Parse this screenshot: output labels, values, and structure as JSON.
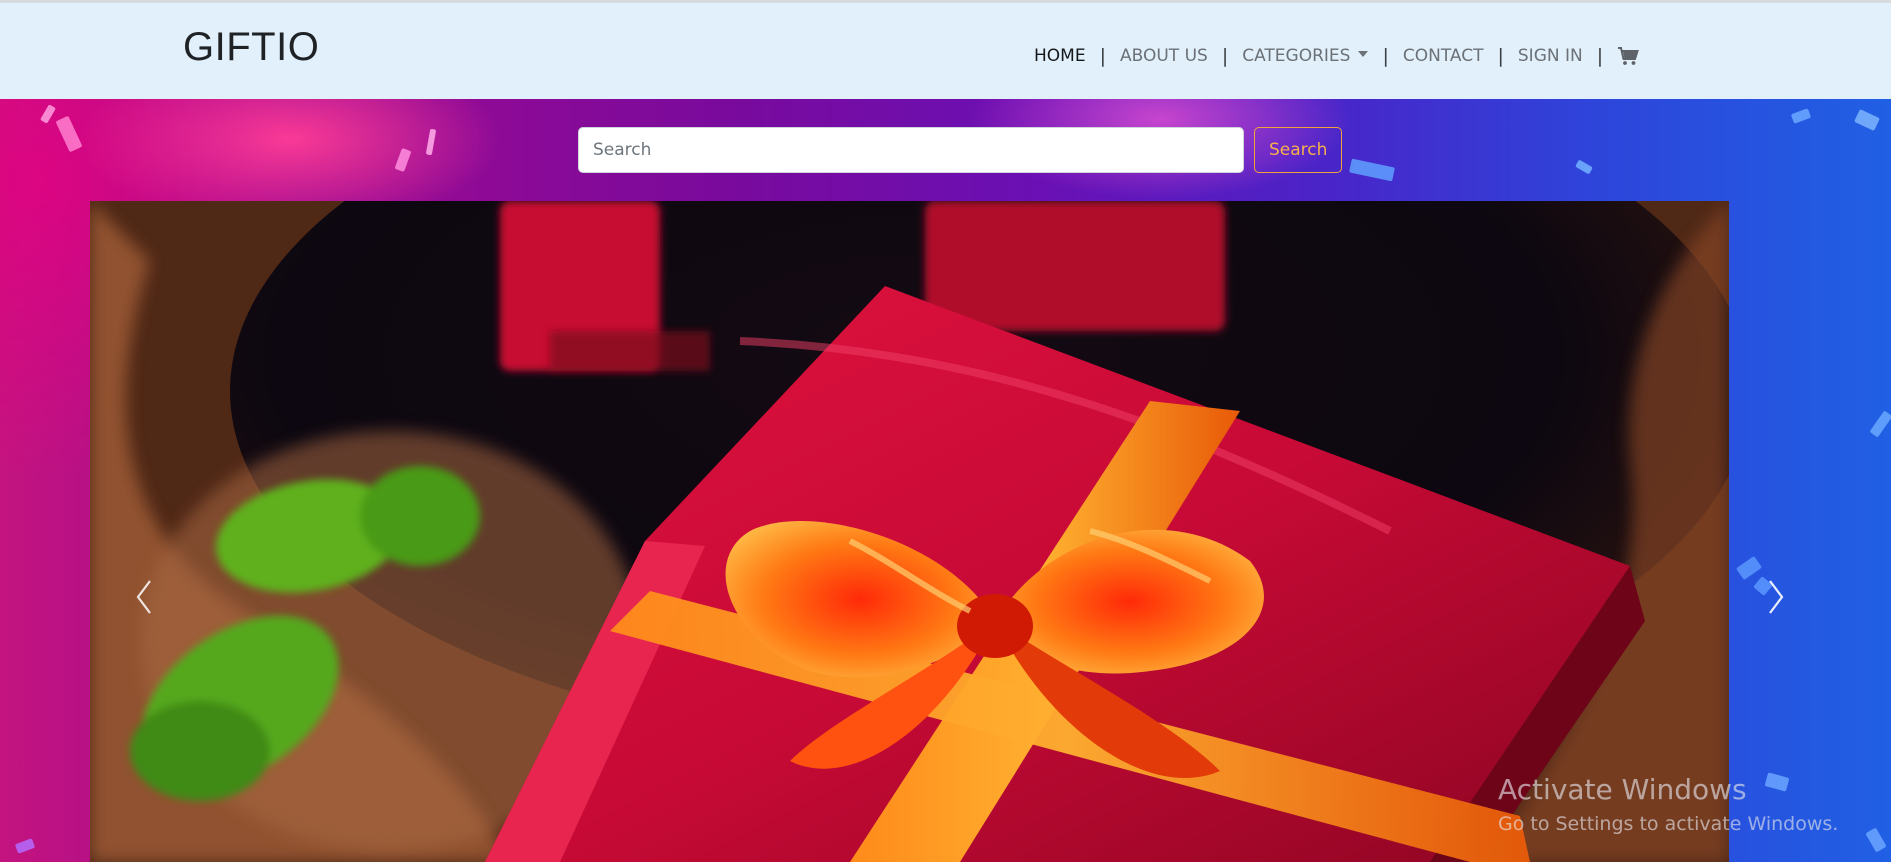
{
  "navbar": {
    "brand": "GIFTIO",
    "links": [
      {
        "label": "HOME",
        "active": true
      },
      {
        "label": "ABOUT US"
      },
      {
        "label": "CATEGORIES",
        "dropdown": true
      },
      {
        "label": "CONTACT"
      },
      {
        "label": "SIGN IN"
      }
    ],
    "separator": "|",
    "cart_icon": "shopping-cart-icon"
  },
  "search": {
    "placeholder": "Search",
    "value": "",
    "button_label": "Search"
  },
  "carousel": {
    "slide_description_icon": "gift-box-photo",
    "prev_icon": "chevron-left-icon",
    "next_icon": "chevron-right-icon"
  },
  "watermark": {
    "title": "Activate Windows",
    "subtitle": "Go to Settings to activate Windows."
  },
  "colors": {
    "navbar_bg": "#e2f0fb",
    "search_button_accent": "#f7b04a",
    "hero_left": "#c4147f",
    "hero_right": "#2060e4"
  }
}
